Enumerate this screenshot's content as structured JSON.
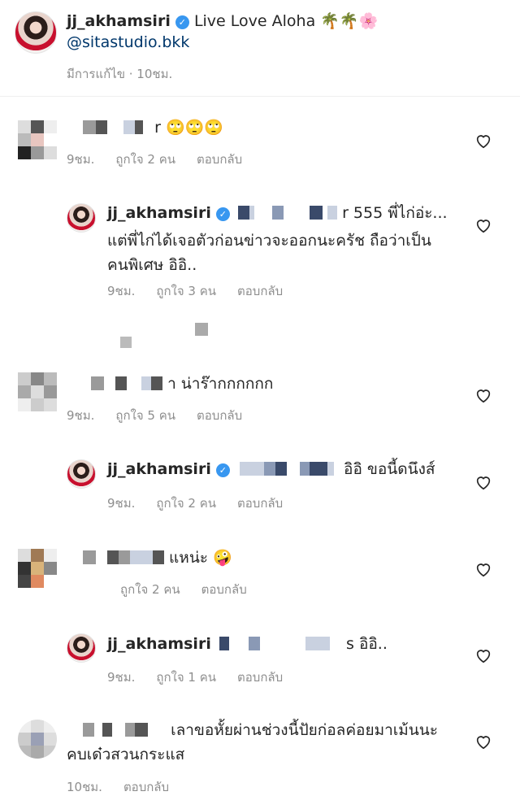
{
  "caption": {
    "username": "jj_akhamsiri",
    "text": "Live Love Aloha 🌴🌴🌸",
    "mention": "@sitastudio.bkk",
    "meta": "มีการแก้ไข · 10ชม."
  },
  "comments": [
    {
      "text": "r 🙄🙄🙄",
      "time": "9ชม.",
      "likes": "ถูกใจ 2 คน",
      "reply": "ตอบกลับ"
    },
    {
      "username": "jj_akhamsiri",
      "text": "r 555 พี่ไก่อ่ะ...",
      "text2": "แต่พี่ไก่ได้เจอตัวก่อนข่าวจะออกนะครัช ถือว่าเป็น",
      "text3": "คนพิเศษ อิอิ..",
      "time": "9ชม.",
      "likes": "ถูกใจ 3 คน",
      "reply": "ตอบกลับ"
    },
    {
      "text": "า น่าร๊ากกกกกก",
      "time": "9ชม.",
      "likes": "ถูกใจ 5 คน",
      "reply": "ตอบกลับ"
    },
    {
      "username": "jj_akhamsiri",
      "text": "อิอิ ขอนี้ดนึงส์",
      "time": "9ชม.",
      "likes": "ถูกใจ 2 คน",
      "reply": "ตอบกลับ"
    },
    {
      "text": "แหน่ะ 🤪",
      "likes": "ถูกใจ 2 คน",
      "reply": "ตอบกลับ"
    },
    {
      "username": "jj_akhamsiri",
      "text": "s อิอิ..",
      "time": "9ชม.",
      "likes": "ถูกใจ 1 คน",
      "reply": "ตอบกลับ"
    },
    {
      "text": "เลาขอหั้ยผ่านช่วงนี้ปัยก่อลค่อยมาเม้นนะ",
      "text2": "คบเด๋วสวนกระแส",
      "time": "10ชม.",
      "reply": "ตอบกลับ"
    }
  ]
}
